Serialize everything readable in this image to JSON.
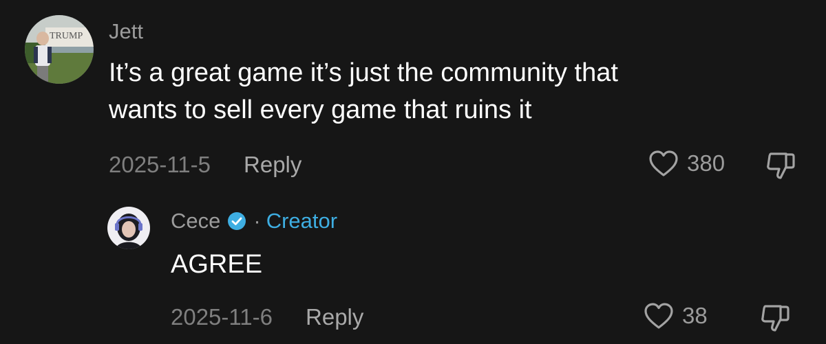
{
  "comments": [
    {
      "author": "Jett",
      "avatar_icon": "user-avatar-photo",
      "avatar_sign_text": "TRUMP",
      "text": "It’s a great game it’s just the community that\nwants to sell every game that ruins it",
      "date": "2025-11-5",
      "reply_label": "Reply",
      "likes": "380",
      "like_icon": "heart-icon",
      "dislike_icon": "thumbs-down-icon"
    }
  ],
  "replies": [
    {
      "author": "Cece",
      "verified": true,
      "verified_color": "#3eaee2",
      "separator": "·",
      "creator_label": "Creator",
      "avatar_icon": "creator-avatar-photo",
      "text": "AGREE",
      "date": "2025-11-6",
      "reply_label": "Reply",
      "likes": "38",
      "like_icon": "heart-icon",
      "dislike_icon": "thumbs-down-icon"
    }
  ],
  "colors": {
    "background": "#161616",
    "primary_text": "#ffffff",
    "secondary_text": "#9c9c9c",
    "creator_accent": "#3eaee2"
  }
}
